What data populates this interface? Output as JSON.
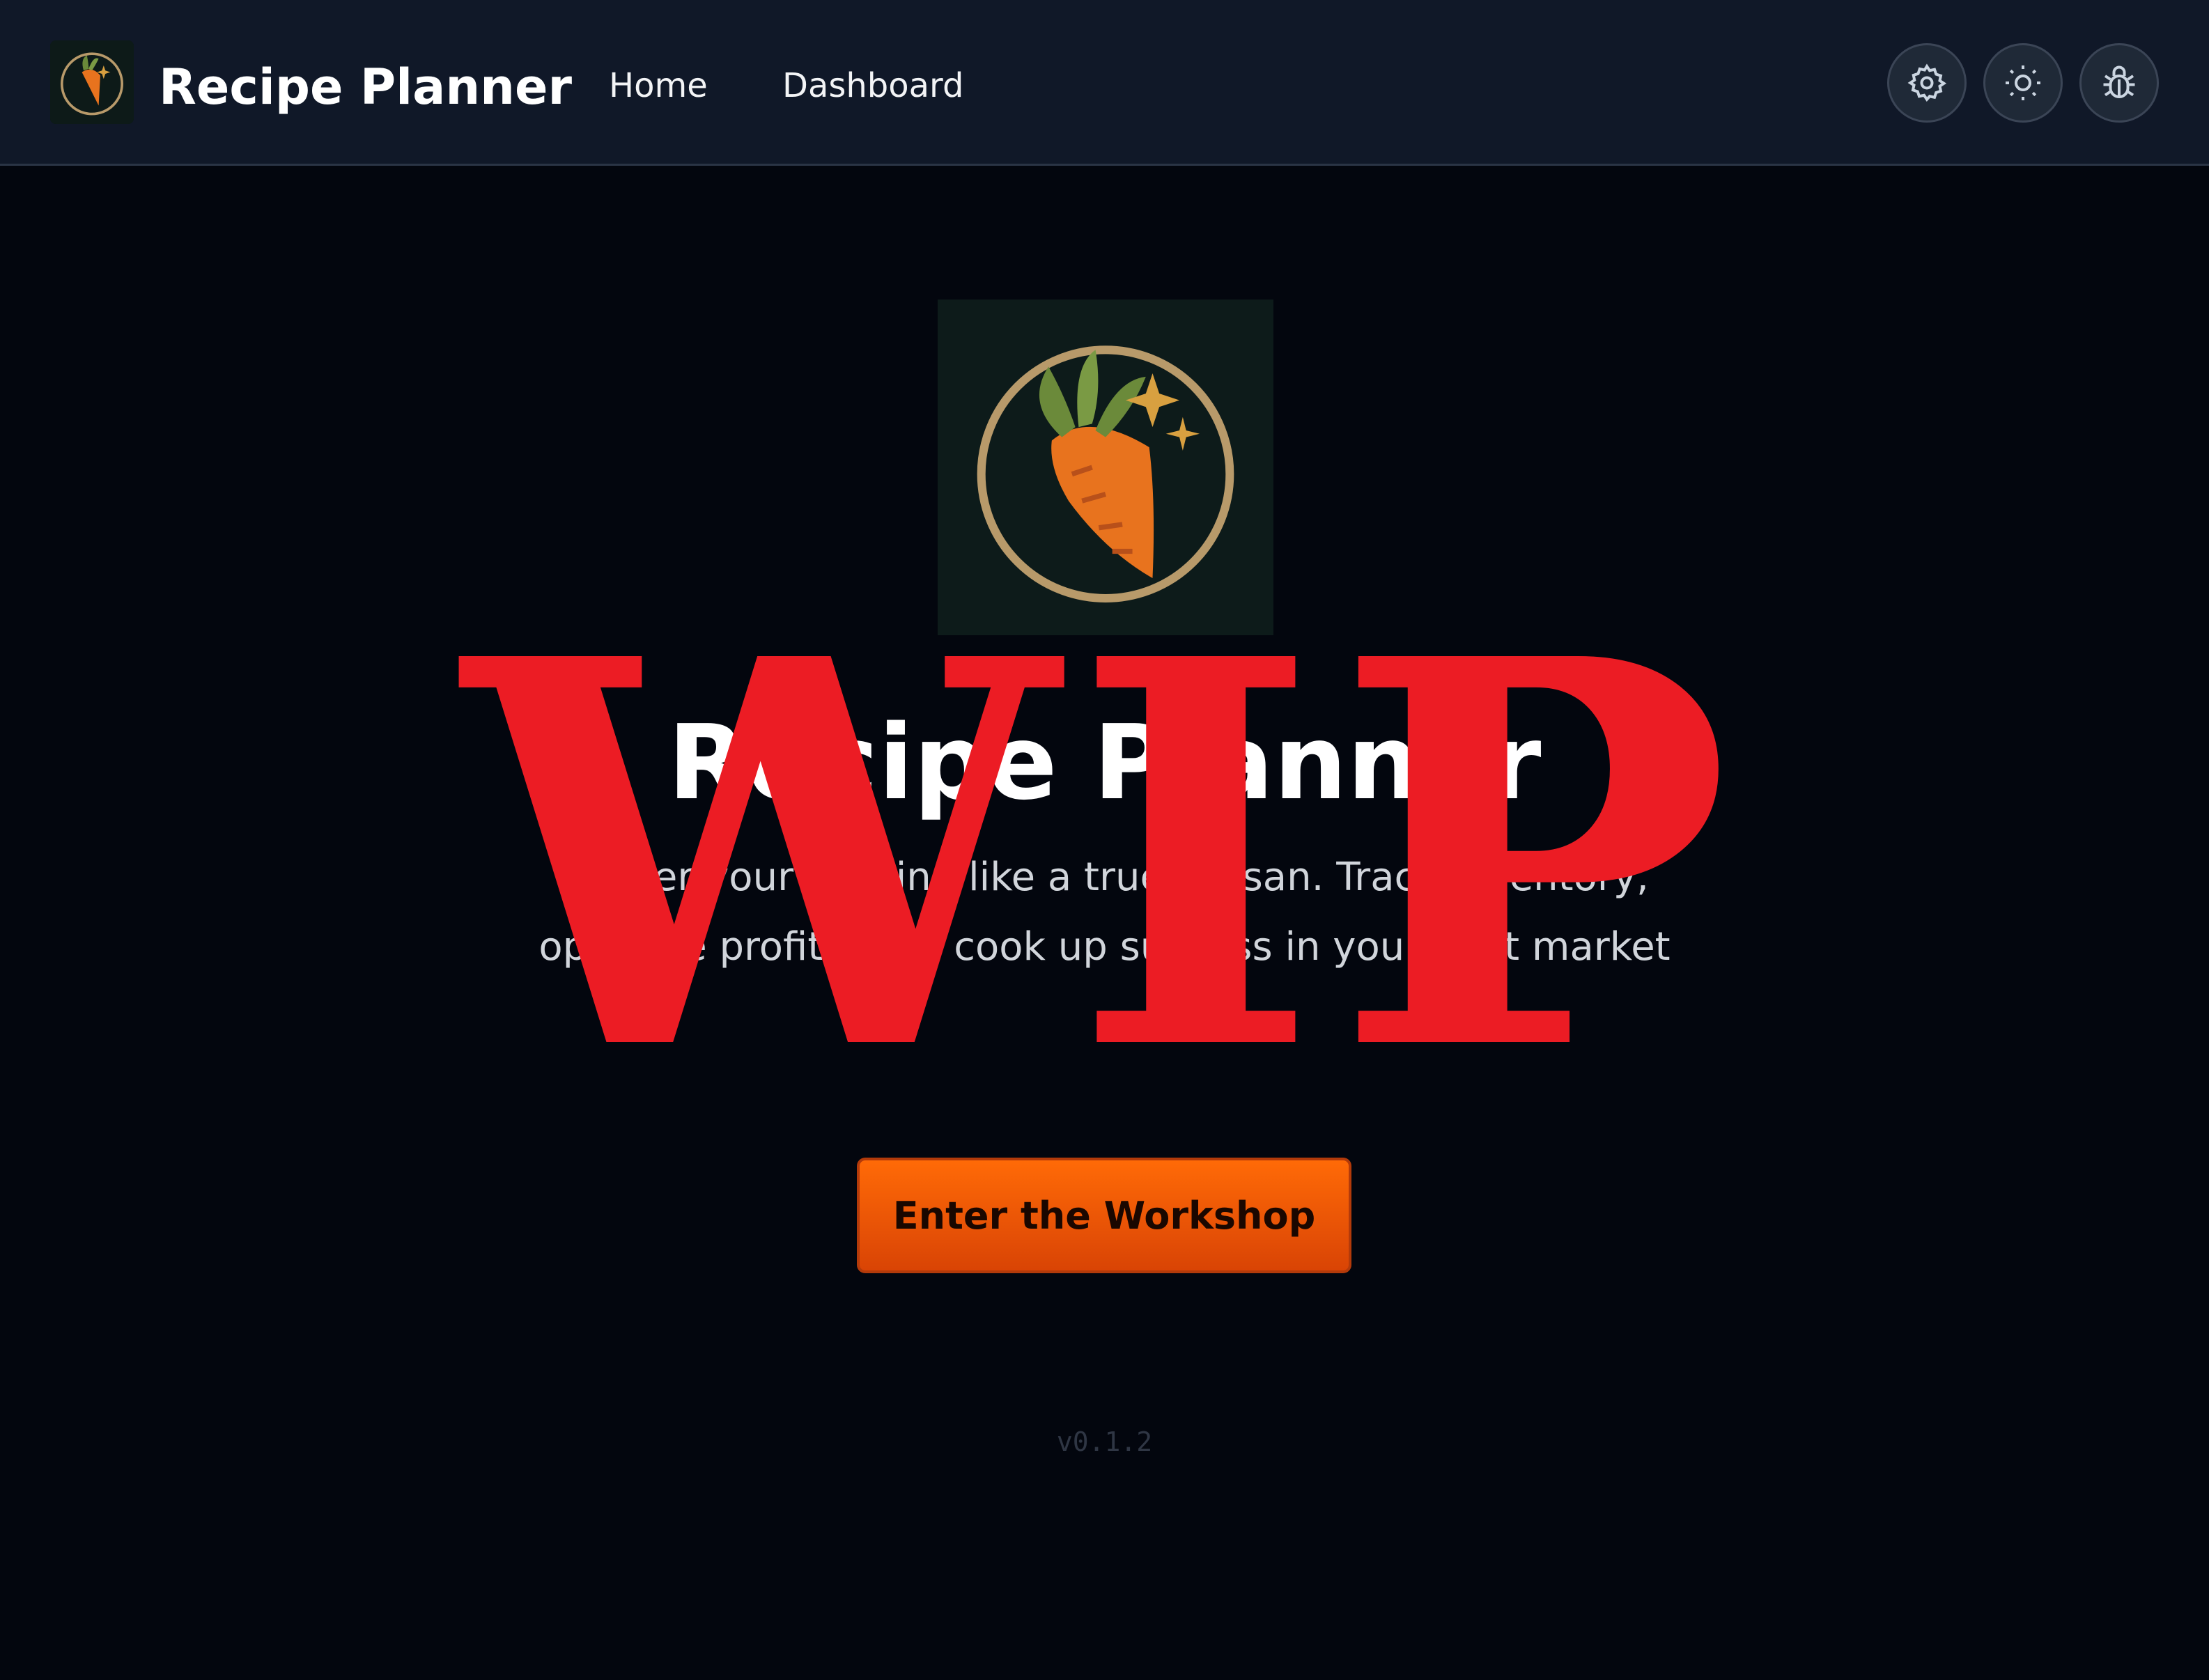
{
  "navbar": {
    "title": "Recipe Planner",
    "links": [
      {
        "label": "Home"
      },
      {
        "label": "Dashboard"
      }
    ],
    "icons": [
      "settings-icon",
      "sun-icon",
      "bug-icon"
    ]
  },
  "hero": {
    "title": "Recipe Planner",
    "subtitle_line1": "Master your crafting like a true artisan. Track inventory,",
    "subtitle_line2": "optimize profits, and cook up success in your next market",
    "cta_label": "Enter the Workshop",
    "version": "v0.1.2"
  },
  "overlay": {
    "text": "WIP",
    "color": "#ec1c24"
  },
  "colors": {
    "accent": "#ff6a07",
    "navbar": "#101828",
    "background": "#03060e"
  }
}
